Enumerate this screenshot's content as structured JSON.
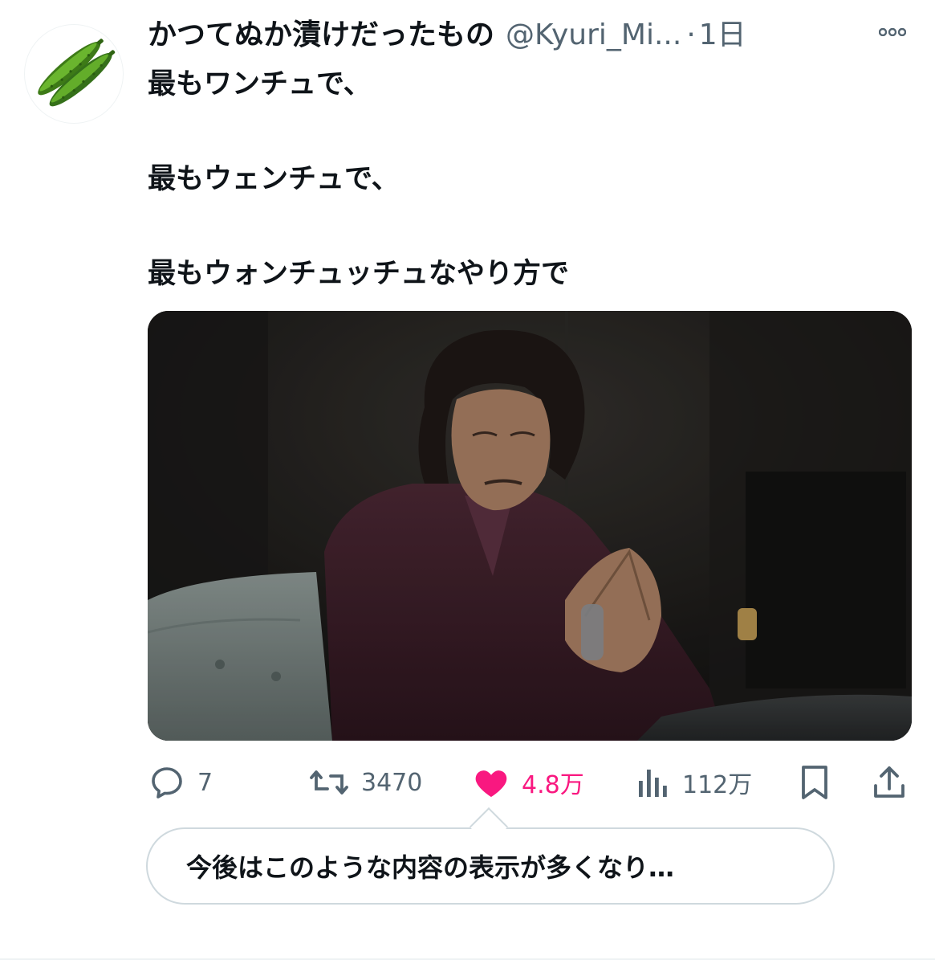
{
  "tweet": {
    "author": {
      "display_name": "かつてぬか漬けだったもの",
      "handle": "@Kyuri_Mi...",
      "avatar_icon": "cucumber-emoji"
    },
    "separator": "·",
    "timestamp": "1日",
    "more_icon": "more-dots-icon",
    "text_lines": [
      "最もワンチュで、",
      "最もウェンチュで、",
      "最もウォンチュッチュなやり方で"
    ],
    "media": {
      "kind": "photo"
    },
    "actions": {
      "reply": {
        "icon": "reply-icon",
        "count": "7"
      },
      "retweet": {
        "icon": "retweet-icon",
        "count": "3470"
      },
      "like": {
        "icon": "heart-icon",
        "count": "4.8万",
        "liked": true
      },
      "views": {
        "icon": "views-icon",
        "count": "112万"
      },
      "bookmark": {
        "icon": "bookmark-icon"
      },
      "share": {
        "icon": "share-icon"
      }
    },
    "feedback_prompt": "今後はこのような内容の表示が多くなり…"
  },
  "colors": {
    "text_primary": "#0f1419",
    "text_secondary": "#536471",
    "like_pink": "#f91880",
    "border": "#cfd9de",
    "cucumber_green": "#4a8a1f"
  }
}
